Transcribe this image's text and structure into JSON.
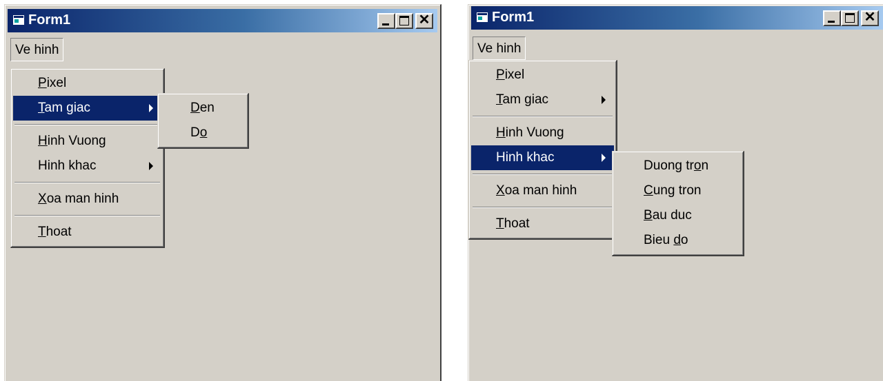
{
  "left_window": {
    "title": "Form1",
    "menubar": {
      "item": "Ve hinh"
    },
    "menu": {
      "pixel": {
        "mnemonic": "P",
        "rest": "ixel"
      },
      "tam_giac": {
        "mnemonic": "T",
        "rest": "am giac"
      },
      "hinh_vuong": {
        "mnemonic": "H",
        "rest": "inh Vuong"
      },
      "hinh_khac": {
        "label": "Hinh khac"
      },
      "xoa_man_hinh": {
        "mnemonic": "X",
        "rest": "oa man hinh"
      },
      "thoat": {
        "mnemonic": "T",
        "rest": "hoat"
      }
    },
    "submenu_tam_giac": {
      "den": {
        "mnemonic": "D",
        "rest": "en"
      },
      "do": {
        "pre": "D",
        "mnemonic": "o"
      }
    },
    "title_buttons": {
      "close_glyph": "✕"
    }
  },
  "right_window": {
    "title": "Form1",
    "menubar": {
      "item": "Ve hinh"
    },
    "menu": {
      "pixel": {
        "mnemonic": "P",
        "rest": "ixel"
      },
      "tam_giac": {
        "mnemonic": "T",
        "rest": "am giac"
      },
      "hinh_vuong": {
        "mnemonic": "H",
        "rest": "inh Vuong"
      },
      "hinh_khac": {
        "label": "Hinh khac"
      },
      "xoa_man_hinh": {
        "mnemonic": "X",
        "rest": "oa man hinh"
      },
      "thoat": {
        "mnemonic": "T",
        "rest": "hoat"
      }
    },
    "submenu_hinh_khac": {
      "duong_tron": {
        "pre": "Duong tr",
        "mnemonic": "o",
        "rest": "n"
      },
      "cung_tron": {
        "mnemonic": "C",
        "rest": "ung tron"
      },
      "bau_duc": {
        "mnemonic": "B",
        "rest": "au duc"
      },
      "bieu_do": {
        "pre": "Bieu ",
        "mnemonic": "d",
        "rest": "o"
      }
    },
    "title_buttons": {
      "close_glyph": "✕"
    }
  },
  "colors": {
    "title_gradient_start": "#0a246a",
    "title_gradient_end": "#a6caf0",
    "highlight": "#0a246a",
    "face": "#d4d0c8"
  }
}
